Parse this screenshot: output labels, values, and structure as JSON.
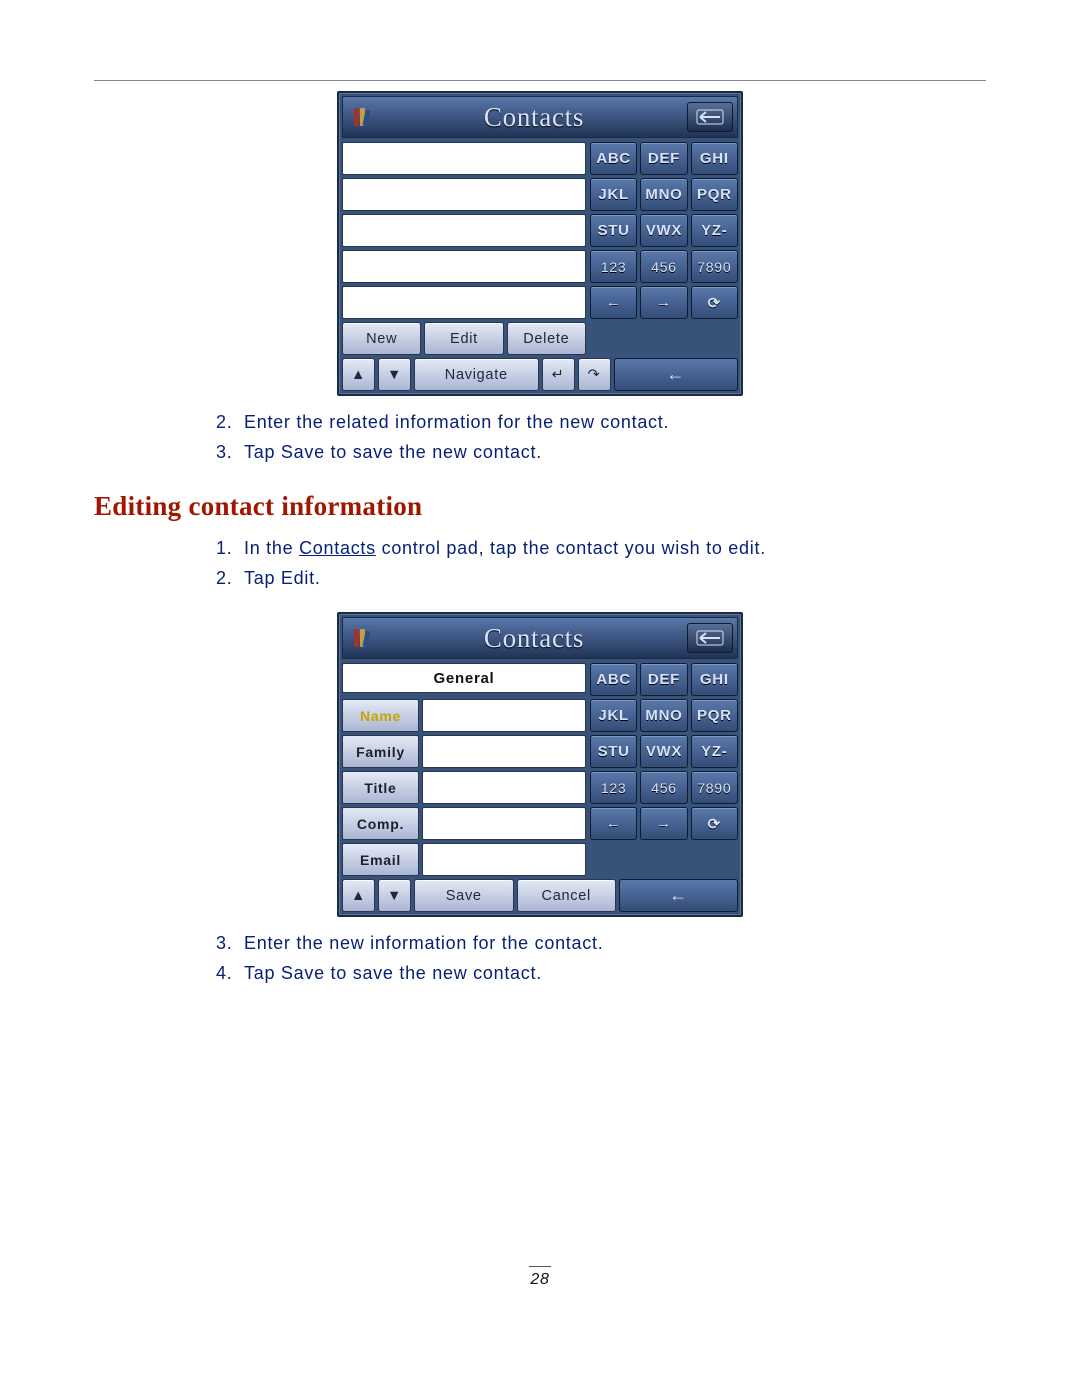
{
  "page_number": "28",
  "section1_steps": [
    {
      "num": "2.",
      "prefix": "Enter the related information for the new contact."
    },
    {
      "num": "3.",
      "prefix": "Tap ",
      "btn": "Save",
      "suffix": " to save the new contact."
    }
  ],
  "heading": "Editing contact information",
  "section2_steps_a": [
    {
      "num": "1.",
      "prefix": "In the ",
      "link": "Contacts",
      "suffix": " control pad, tap the contact you wish to edit."
    },
    {
      "num": "2.",
      "prefix": "Tap ",
      "btn": "Edit",
      "suffix": "."
    }
  ],
  "section2_steps_b": [
    {
      "num": "3.",
      "prefix": "Enter the new information for the contact."
    },
    {
      "num": "4.",
      "prefix": "Tap ",
      "btn": "Save",
      "suffix": " to save the new contact."
    }
  ],
  "device1": {
    "title": "Contacts",
    "keypad": [
      "ABC",
      "DEF",
      "GHI",
      "JKL",
      "MNO",
      "PQR",
      "STU",
      "VWX",
      "YZ-",
      "123",
      "456",
      "7890"
    ],
    "arrows": [
      "←",
      "→",
      "⟳"
    ],
    "buttons": {
      "new": "New",
      "edit": "Edit",
      "delete": "Delete",
      "navigate": "Navigate"
    },
    "nav_icons": [
      "▲",
      "▼"
    ],
    "bottom_arrows": [
      "↵",
      "↷",
      "←"
    ]
  },
  "device2": {
    "title": "Contacts",
    "form_header": "General",
    "fields": [
      {
        "label": "Name",
        "selected": true
      },
      {
        "label": "Family",
        "selected": false
      },
      {
        "label": "Title",
        "selected": false
      },
      {
        "label": "Comp.",
        "selected": false
      },
      {
        "label": "Email",
        "selected": false
      }
    ],
    "keypad": [
      "ABC",
      "DEF",
      "GHI",
      "JKL",
      "MNO",
      "PQR",
      "STU",
      "VWX",
      "YZ-",
      "123",
      "456",
      "7890"
    ],
    "arrows": [
      "←",
      "→",
      "⟳"
    ],
    "buttons": {
      "save": "Save",
      "cancel": "Cancel"
    },
    "nav_icons": [
      "▲",
      "▼"
    ],
    "bottom_arrow": "←"
  }
}
